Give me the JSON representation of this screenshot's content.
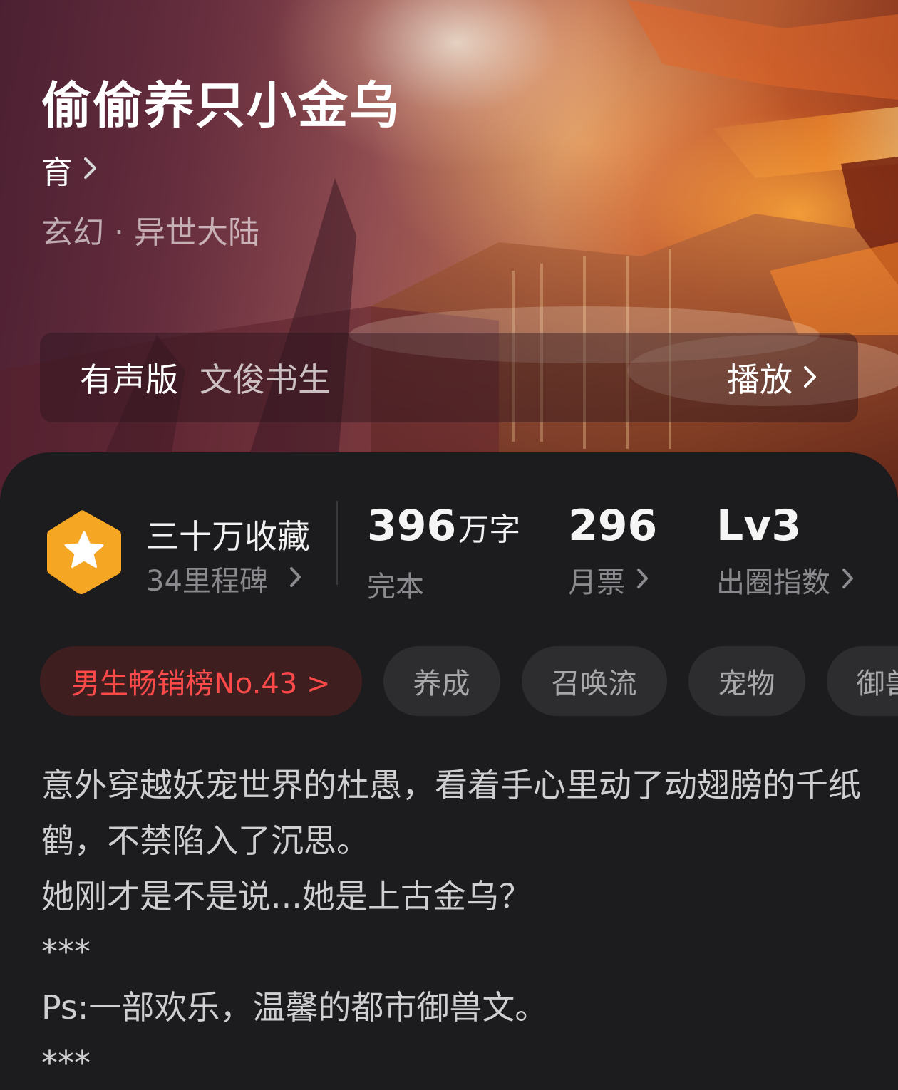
{
  "book": {
    "title": "偷偷养只小金乌",
    "author": "育",
    "genre": "玄幻 · 异世大陆"
  },
  "audio": {
    "label": "有声版",
    "narrator": "文俊书生",
    "play_label": "播放"
  },
  "stats": {
    "favorites": "三十万收藏",
    "milestones": "34里程碑",
    "words_value": "396",
    "words_unit": "万字",
    "status": "完本",
    "monthly_votes": "296",
    "monthly_votes_label": "月票",
    "level": "Lv3",
    "level_label": "出圈指数"
  },
  "tags": {
    "rank": "男生畅销榜No.43 >",
    "items": [
      "养成",
      "召唤流",
      "宠物",
      "御兽"
    ]
  },
  "intro": {
    "lines": [
      "意外穿越妖宠世界的杜愚，看着手心里动了动翅膀的千纸鹤，不禁陷入了沉思。",
      "她刚才是不是说...她是上古金乌？",
      "***",
      "Ps:一部欢乐，温馨的都市御兽文。",
      "***"
    ]
  },
  "colors": {
    "sheet_bg": "#1c1c1e",
    "rank_text": "#ff4a4a",
    "rank_bg": "#3e1e1f",
    "badge": "#f5a623",
    "tag_bg": "#2d2d2f"
  }
}
